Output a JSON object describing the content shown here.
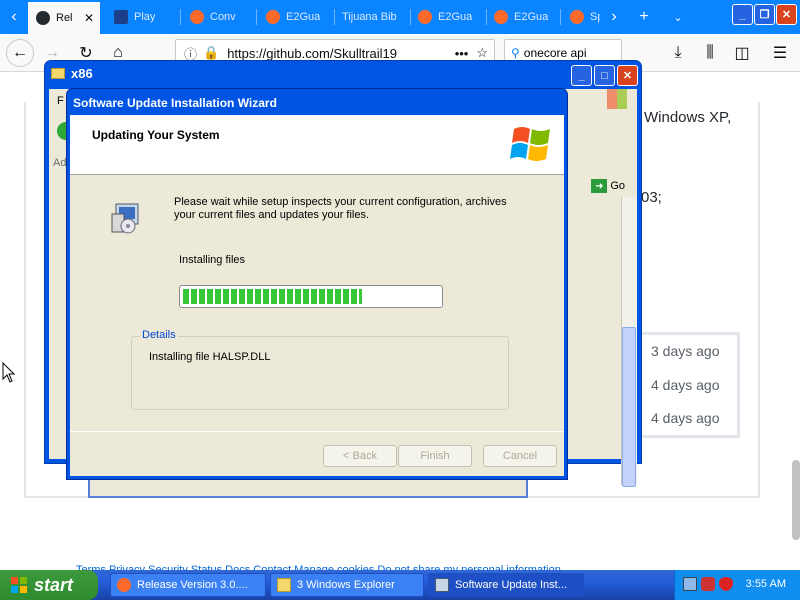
{
  "browser": {
    "tabs": [
      {
        "label": "Rel",
        "icon": "github-icon",
        "active": true
      },
      {
        "label": "Play",
        "icon": "play-icon"
      },
      {
        "label": "Conv",
        "icon": "firefox-icon"
      },
      {
        "label": "E2Gua",
        "icon": "firefox-icon"
      },
      {
        "label": "Tijuana Bib",
        "icon": "page-icon"
      },
      {
        "label": "E2Gua",
        "icon": "firefox-icon"
      },
      {
        "label": "E2Gua",
        "icon": "firefox-icon"
      },
      {
        "label": "Sp",
        "icon": "firefox-icon"
      }
    ],
    "url": "https://github.com/Skulltrail19",
    "search_value": "onecore api"
  },
  "page": {
    "text_windows": "Windows XP,",
    "text_03": "03;",
    "commit_times": [
      "3 days ago",
      "4 days ago",
      "4 days ago"
    ],
    "footer_links": "Terms  Privacy  Security  Status  Docs  Contact  Manage cookies  Do not share my personal information"
  },
  "explorer": {
    "title": "x86",
    "go_label": "Go",
    "menu_letter": "F",
    "address_abbr": "Ad"
  },
  "wizard": {
    "title": "Software Update Installation Wizard",
    "heading": "Updating Your System",
    "message": "Please wait while setup inspects your current configuration, archives your current files and updates your files.",
    "status": "Installing files",
    "progress_fraction": 0.7,
    "details_legend": "Details",
    "details_text": "Installing file HALSP.DLL",
    "buttons": {
      "back": "< Back",
      "finish": "Finish",
      "cancel": "Cancel"
    }
  },
  "taskbar": {
    "start_label": "start",
    "tasks": [
      {
        "label": "Release Version 3.0....",
        "icon": "firefox-icon"
      },
      {
        "label": "3 Windows Explorer",
        "icon": "folder-icon"
      },
      {
        "label": "Software Update Inst...",
        "icon": "installer-icon",
        "active": true
      }
    ],
    "clock": "3:55 AM"
  }
}
